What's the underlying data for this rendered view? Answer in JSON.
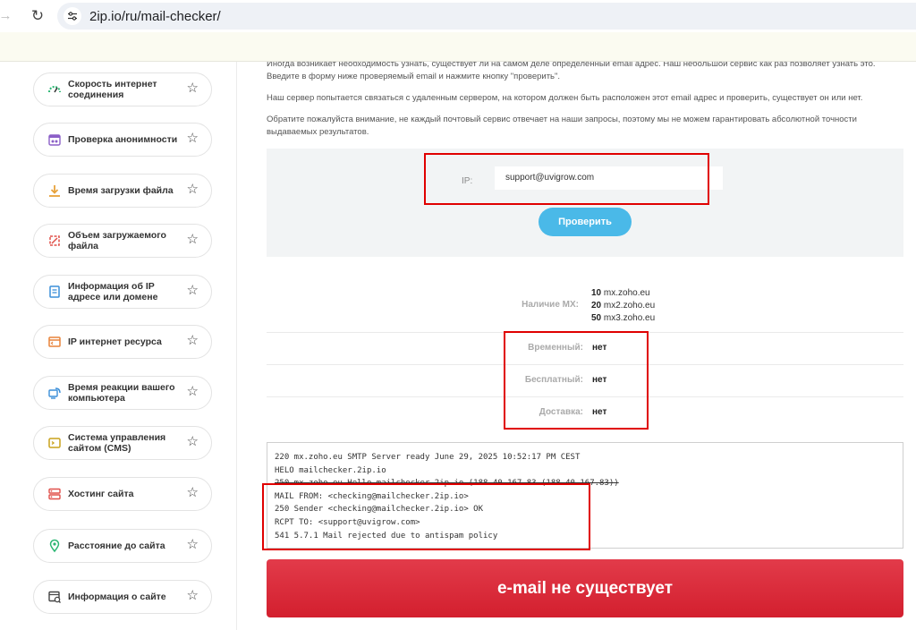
{
  "browser": {
    "url": "2ip.io/ru/mail-checker/",
    "back_glyph": "→",
    "reload_glyph": "↻"
  },
  "sidebar": {
    "items": [
      {
        "label": "Скорость интернет соединения",
        "icon": "speedometer-icon"
      },
      {
        "label": "Проверка анонимности",
        "icon": "incognito-icon"
      },
      {
        "label": "Время загрузки файла",
        "icon": "download-icon"
      },
      {
        "label": "Объем загружаемого файла",
        "icon": "file-size-icon"
      },
      {
        "label": "Информация об IP адресе или домене",
        "icon": "ip-info-icon"
      },
      {
        "label": "IP интернет ресурса",
        "icon": "browser-window-icon"
      },
      {
        "label": "Время реакции вашего компьютера",
        "icon": "ping-icon"
      },
      {
        "label": "Система управления сайтом (CMS)",
        "icon": "terminal-icon"
      },
      {
        "label": "Хостинг сайта",
        "icon": "server-icon"
      },
      {
        "label": "Расстояние до сайта",
        "icon": "location-pin-icon"
      },
      {
        "label": "Информация о сайте",
        "icon": "site-info-icon"
      }
    ],
    "star_glyph": "☆"
  },
  "intro": {
    "p1_line1": "Иногда возникает необходимость узнать, существует ли на самом деле определенный email адрес. Наш небольшой сервис как раз позволяет узнать это.",
    "p1_line2": "Введите в форму ниже проверяемый email и нажмите кнопку \"проверить\".",
    "p2": "Наш сервер попытается связаться с удаленным сервером, на котором должен быть расположен этот email адрес и проверить, существует он или нет.",
    "p3_line1": "Обратите пожалуйста внимание, не каждый почтовый сервис отвечает на наши запросы, поэтому мы не можем гарантировать абсолютной точности",
    "p3_line2": "выдаваемых результатов."
  },
  "form": {
    "label": "IP:",
    "value": "support@uvigrow.com",
    "button": "Проверить"
  },
  "results": {
    "mx_label": "Наличие MX:",
    "mx_records": [
      {
        "priority": "10",
        "host": "mx.zoho.eu"
      },
      {
        "priority": "20",
        "host": "mx2.zoho.eu"
      },
      {
        "priority": "50",
        "host": "mx3.zoho.eu"
      }
    ],
    "rows": [
      {
        "key": "Временный:",
        "value": "нет"
      },
      {
        "key": "Бесплатный:",
        "value": "нет"
      },
      {
        "key": "Доставка:",
        "value": "нет"
      }
    ]
  },
  "log": {
    "lines": [
      "220 mx.zoho.eu SMTP Server ready June 29, 2025 10:52:17 PM CEST",
      "HELO mailchecker.2ip.io",
      "250 mx.zoho.eu Hello mailchecker.2ip.io (188.40.167.83 (188.40.167.83))",
      "MAIL FROM: <checking@mailchecker.2ip.io>",
      "250 Sender <checking@mailchecker.2ip.io> OK",
      "RCPT TO: <support@uvigrow.com>",
      "541 5.7.1 Mail rejected due to antispam policy"
    ]
  },
  "verdict": "e-mail не существует",
  "colors": {
    "accent_button": "#4ab9e8",
    "verdict_bg": "#d92434",
    "highlight": "#e00000"
  }
}
